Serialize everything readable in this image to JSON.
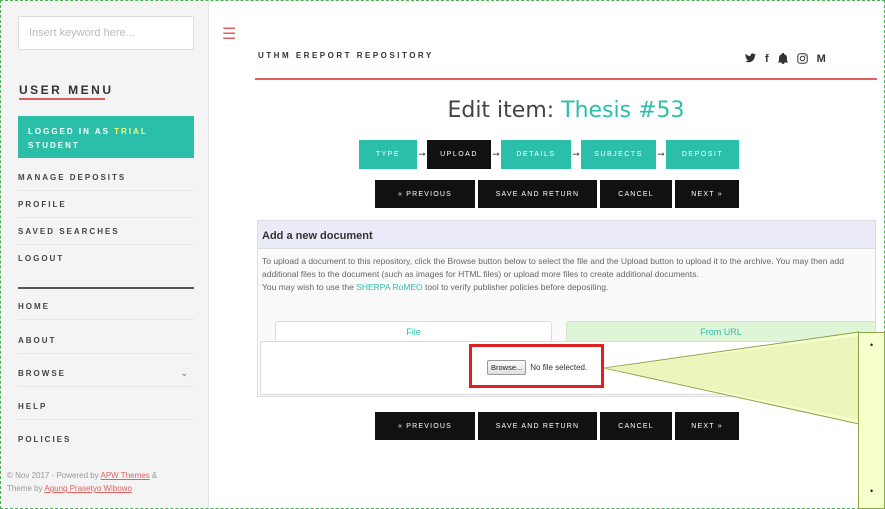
{
  "sidebar": {
    "search_placeholder": "Insert keyword here...",
    "user_menu_title": "USER MENU",
    "logged_in_prefix": "LOGGED IN AS ",
    "logged_in_user_line1": "TRIAL",
    "logged_in_user_line2": "STUDENT",
    "user_items": [
      "MANAGE DEPOSITS",
      "PROFILE",
      "SAVED SEARCHES",
      "LOGOUT"
    ],
    "nav_items": [
      "HOME",
      "ABOUT",
      "BROWSE",
      "HELP",
      "POLICIES"
    ],
    "footer_line1_prefix": "© Nov 2017 - Powered by ",
    "footer_link1": "APW Themes",
    "footer_line1_suffix": " &",
    "footer_line2_prefix": "Theme by ",
    "footer_link2": "Agung Prasetyo Wibowo"
  },
  "header": {
    "site_title": "UTHM EREPORT REPOSITORY",
    "social_icons": [
      "twitter-icon",
      "facebook-icon",
      "bell-icon",
      "instagram-icon",
      "medium-icon"
    ],
    "social_glyphs": [
      "❤",
      "f",
      "☺",
      "◎",
      "M"
    ]
  },
  "page": {
    "title_prefix": "Edit item: ",
    "title_item": "Thesis #53"
  },
  "steps": [
    {
      "label": "TYPE",
      "state": "done"
    },
    {
      "label": "UPLOAD",
      "state": "current"
    },
    {
      "label": "DETAILS",
      "state": "todo"
    },
    {
      "label": "SUBJECTS",
      "state": "todo"
    },
    {
      "label": "DEPOSIT",
      "state": "todo"
    }
  ],
  "buttons": {
    "previous": "« PREVIOUS",
    "save_return": "SAVE AND RETURN",
    "cancel": "CANCEL",
    "next": "NEXT »"
  },
  "panel": {
    "heading": "Add a new document",
    "text1": "To upload a document to this repository, click the Browse button below to select the file and the Upload button to upload it to the archive. You may then add additional files to the document (such as images for HTML files) or upload more files to create additional documents.",
    "text2_prefix": "You may wish to use the ",
    "text2_link": "SHERPA RoMEO",
    "text2_suffix": " tool to verify publisher policies before depositing.",
    "tab_file": "File",
    "tab_url": "From URL",
    "browse_label": "Browse...",
    "no_file": "No file selected."
  },
  "colors": {
    "accent_teal": "#2bbfaa",
    "accent_red": "#e06060",
    "highlight_red": "#e02020",
    "callout_fill": "#f7ffcc"
  }
}
